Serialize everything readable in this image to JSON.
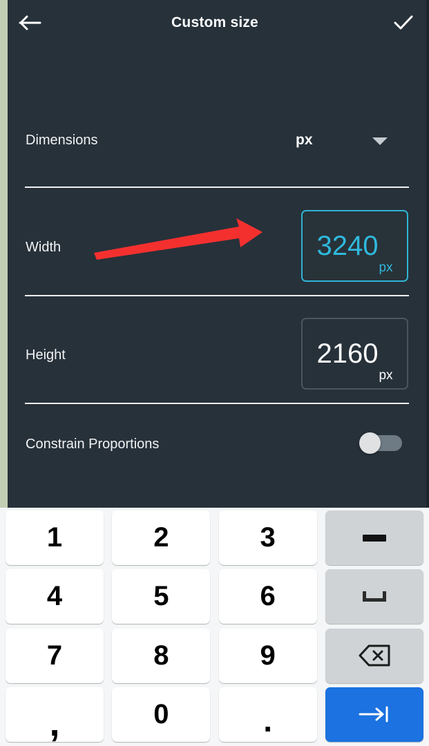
{
  "header": {
    "back_icon": "arrow-left-icon",
    "title": "Custom size",
    "confirm_icon": "check-icon"
  },
  "form": {
    "dimensions": {
      "label": "Dimensions",
      "unit_value": "px",
      "dropdown_icon": "chevron-down-icon"
    },
    "width": {
      "label": "Width",
      "value": "3240",
      "unit": "px",
      "focused": true
    },
    "height": {
      "label": "Height",
      "value": "2160",
      "unit": "px",
      "focused": false
    },
    "constrain": {
      "label": "Constrain Proportions",
      "state": "off"
    }
  },
  "annotation": {
    "type": "arrow",
    "color": "#f4302f",
    "points_to": "width-input"
  },
  "keyboard": {
    "rows": [
      [
        {
          "name": "key-1",
          "label": "1",
          "kind": "digit"
        },
        {
          "name": "key-2",
          "label": "2",
          "kind": "digit"
        },
        {
          "name": "key-3",
          "label": "3",
          "kind": "digit"
        },
        {
          "name": "key-minus",
          "label": "",
          "kind": "func",
          "icon": "minus-icon"
        }
      ],
      [
        {
          "name": "key-4",
          "label": "4",
          "kind": "digit"
        },
        {
          "name": "key-5",
          "label": "5",
          "kind": "digit"
        },
        {
          "name": "key-6",
          "label": "6",
          "kind": "digit"
        },
        {
          "name": "key-space",
          "label": "",
          "kind": "func",
          "icon": "space-icon"
        }
      ],
      [
        {
          "name": "key-7",
          "label": "7",
          "kind": "digit"
        },
        {
          "name": "key-8",
          "label": "8",
          "kind": "digit"
        },
        {
          "name": "key-9",
          "label": "9",
          "kind": "digit"
        },
        {
          "name": "key-backspace",
          "label": "",
          "kind": "func",
          "icon": "backspace-icon"
        }
      ],
      [
        {
          "name": "key-comma",
          "label": ",",
          "kind": "comma"
        },
        {
          "name": "key-0",
          "label": "0",
          "kind": "digit"
        },
        {
          "name": "key-period",
          "label": ".",
          "kind": "period"
        },
        {
          "name": "key-next",
          "label": "",
          "kind": "accent",
          "icon": "tab-next-icon"
        }
      ]
    ]
  },
  "colors": {
    "panel_bg": "#27313a",
    "accent_cyan": "#2fb9dc",
    "accent_blue": "#1b72e0",
    "annotation_red": "#f4302f",
    "keyboard_bg": "#f4f6f7",
    "edge_strip": "#c3cfb4"
  }
}
